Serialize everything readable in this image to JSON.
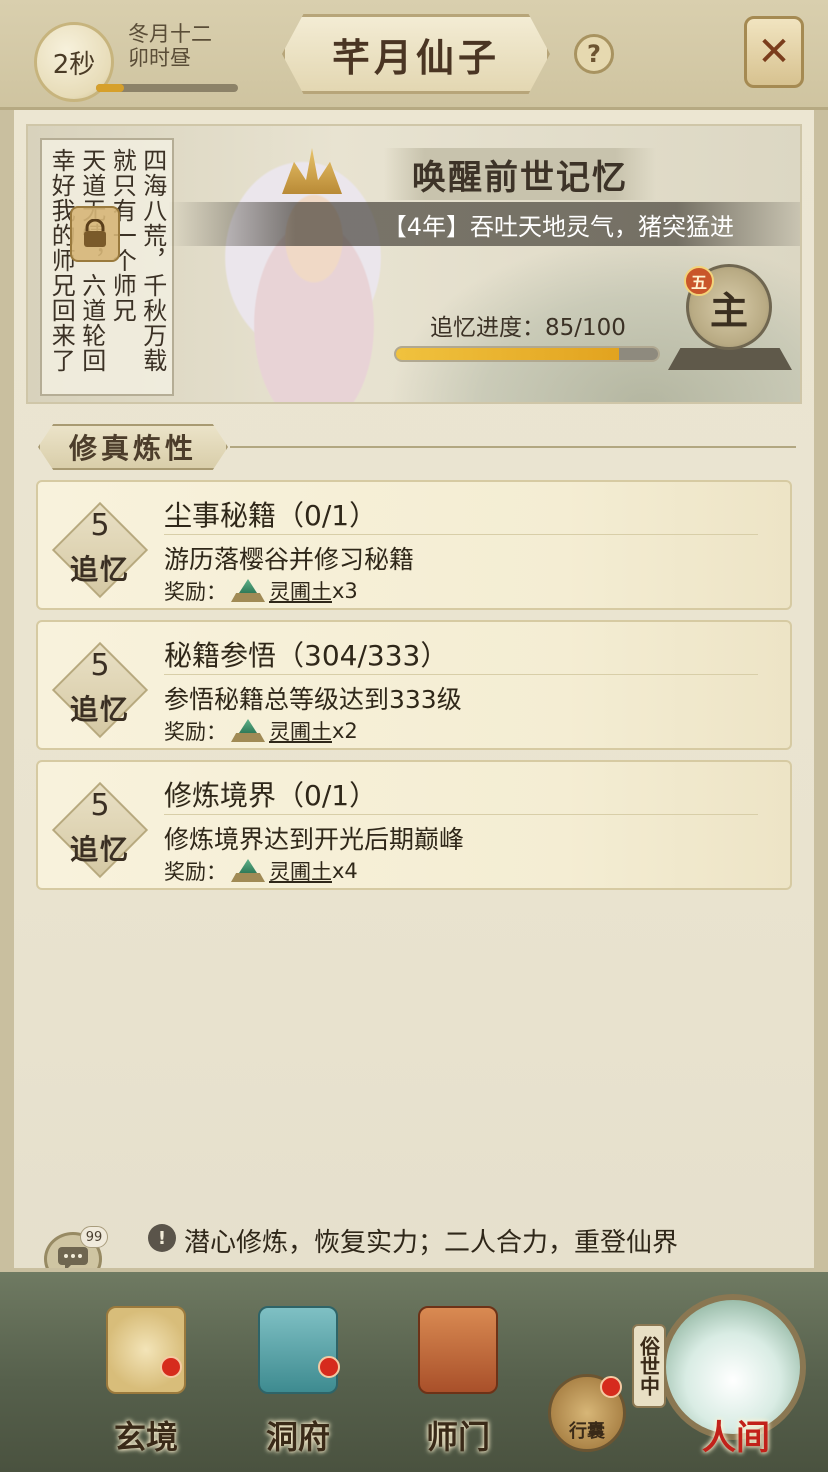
{
  "header": {
    "timer": "2秒",
    "date_line1": "冬月十二",
    "date_line2": "卯时昼",
    "title": "芊月仙子",
    "help_label": "?",
    "close_label": "✕"
  },
  "banner": {
    "poem_columns": [
      "四海八荒，千秋万载",
      "就只有一个师兄",
      "天道无情，六道轮回",
      "幸好我的师兄回来了"
    ],
    "awaken_title": "唤醒前世记忆",
    "event": "【4年】吞吐天地灵气，猪突猛进",
    "progress_text": "追忆进度：85/100",
    "progress_current": 85,
    "progress_max": 100,
    "rank_char": "主",
    "rank_badge": "五"
  },
  "section": {
    "title": "修真炼性"
  },
  "quests": [
    {
      "points": "5",
      "points_label": "追忆",
      "title": "尘事秘籍（0/1）",
      "desc": "游历落樱谷并修习秘籍",
      "reward_label": "奖励：",
      "reward_item": "灵圃土",
      "reward_count": "x3"
    },
    {
      "points": "5",
      "points_label": "追忆",
      "title": "秘籍参悟（304/333）",
      "desc": "参悟秘籍总等级达到333级",
      "reward_label": "奖励：",
      "reward_item": "灵圃土",
      "reward_count": "x2"
    },
    {
      "points": "5",
      "points_label": "追忆",
      "title": "修炼境界（0/1）",
      "desc": "修炼境界达到开光后期巅峰",
      "reward_label": "奖励：",
      "reward_item": "灵圃土",
      "reward_count": "x4"
    }
  ],
  "tip": {
    "chat_count": "99",
    "text": "潜心修炼，恢复实力；二人合力，重登仙界"
  },
  "nav": {
    "xuanjing": "玄境",
    "dongfu": "洞府",
    "shimen": "师门",
    "bag": "行囊",
    "realm_tag": "俗世中",
    "realm": "人间"
  },
  "colors": {
    "accent_gold": "#e2a31f",
    "alert_red": "#d62b1d",
    "realm_red": "#c2211a"
  }
}
